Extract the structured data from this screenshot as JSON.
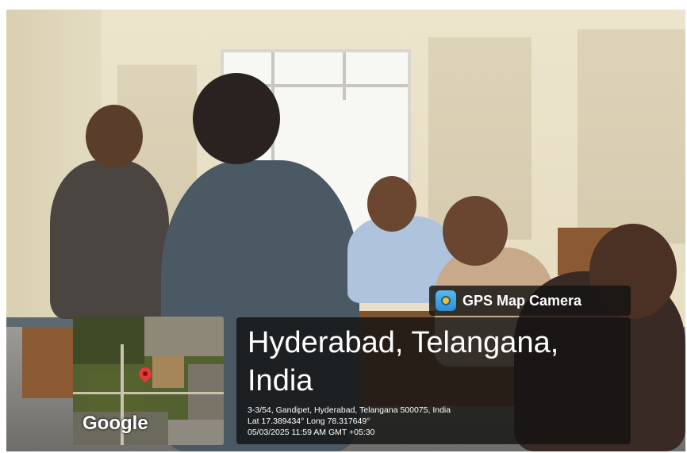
{
  "app": {
    "name": "GPS Map Camera",
    "icon": "gps-camera-icon"
  },
  "location": {
    "title": "Hyderabad, Telangana, India",
    "address": "3-3/54, Gandipet, Hyderabad, Telangana 500075, India",
    "coordinates": "Lat 17.389434° Long 78.317649°",
    "datetime": "05/03/2025 11:59 AM GMT +05:30"
  },
  "map": {
    "provider": "Google",
    "pin_icon": "map-pin-icon"
  },
  "colors": {
    "overlay": "#121212",
    "pin": "#e53935"
  }
}
